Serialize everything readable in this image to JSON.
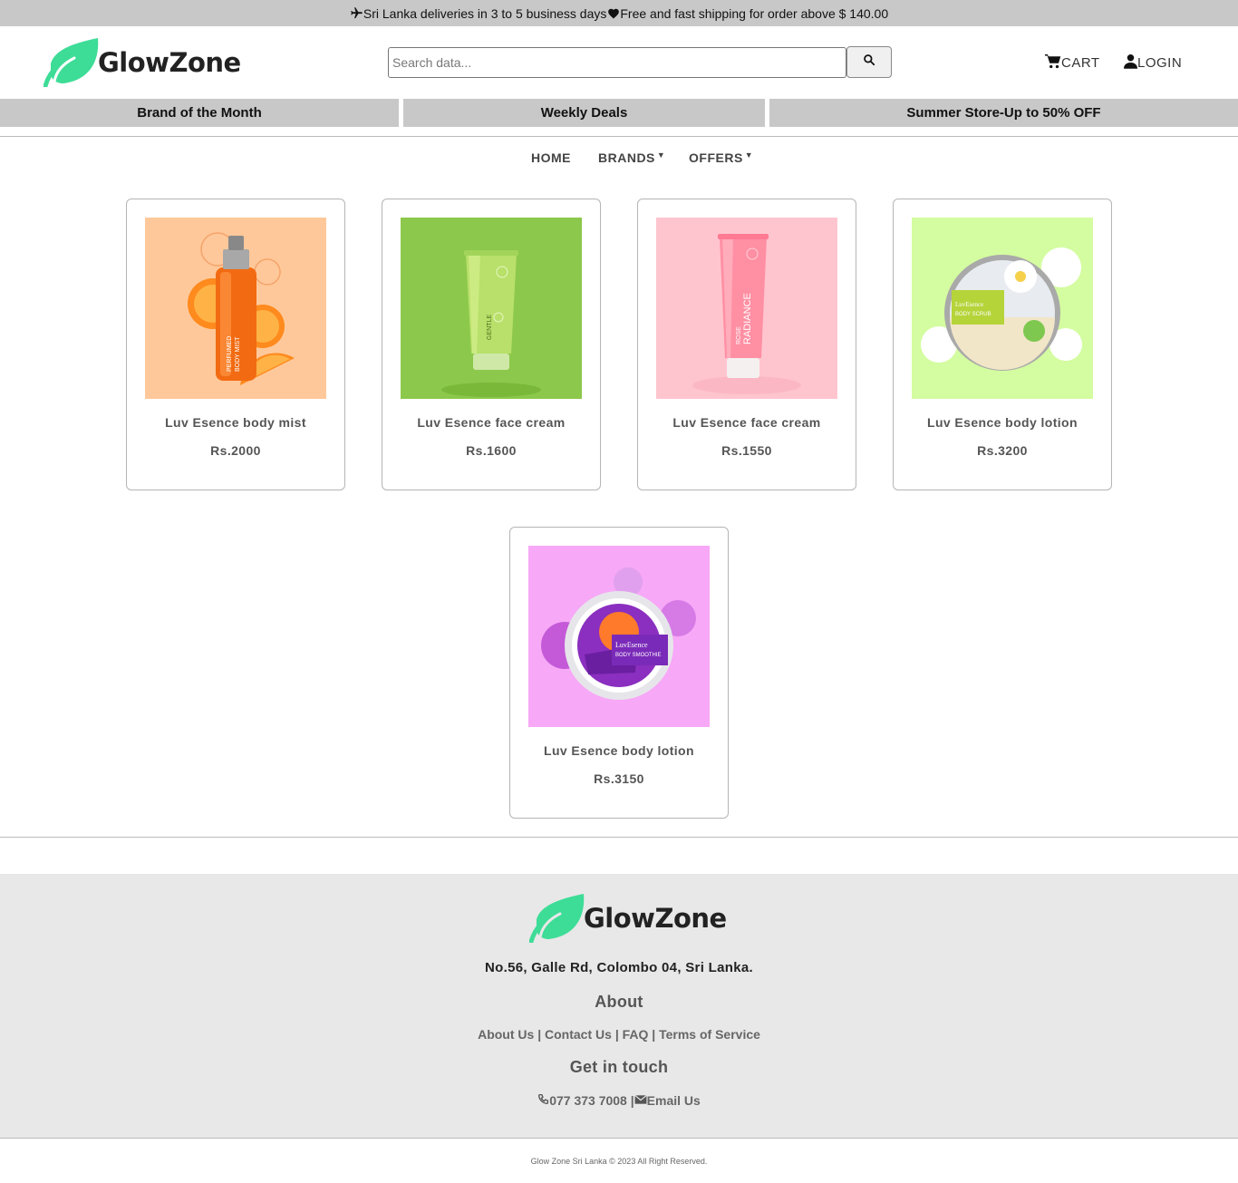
{
  "topbar": {
    "text_part1": "Sri Lanka deliveries in 3 to 5 business days",
    "text_part2": "Free and fast shipping for order above $ 140.00",
    "plane_icon": "airplane-icon",
    "heart_icon": "heart-icon"
  },
  "brand": {
    "name": "GlowZone",
    "leaf_color": "#3ddc97"
  },
  "search": {
    "placeholder": "Search data..."
  },
  "header": {
    "cart_label": "CART",
    "login_label": "LOGIN"
  },
  "promos": [
    "Brand of the Month",
    "Weekly Deals",
    "Summer Store-Up to 50% OFF"
  ],
  "nav": {
    "home": "HOME",
    "brands": "BRANDS",
    "offers": "OFFERS"
  },
  "products": [
    {
      "name": "Luv Esence body mist",
      "price": "Rs.2000",
      "bg": "#ffc89a"
    },
    {
      "name": "Luv Esence face cream",
      "price": "Rs.1600",
      "bg": "#8cc84b"
    },
    {
      "name": "Luv Esence face cream",
      "price": "Rs.1550",
      "bg": "#ffc5cf"
    },
    {
      "name": "Luv Esence body lotion",
      "price": "Rs.3200",
      "bg": "#d4fca0"
    },
    {
      "name": "Luv Esence body lotion",
      "price": "Rs.3150",
      "bg": "#f7a8f7"
    }
  ],
  "product_labels": {
    "mist": [
      "PERFUMED",
      "BODY MIST"
    ],
    "gentle": "GENTLE",
    "rose": [
      "ROSE",
      "RADIANCE"
    ],
    "scrub": [
      "LuvEsence",
      "BODY SCRUB"
    ],
    "smoothie": [
      "LuvEsence",
      "BODY SMOOTHIE"
    ]
  },
  "footer": {
    "address": "No.56, Galle Rd, Colombo 04, Sri Lanka.",
    "about_heading": "About",
    "links": [
      "About Us",
      "Contact Us",
      "FAQ",
      "Terms of Service"
    ],
    "touch_heading": "Get in touch",
    "phone": "077 373 7008",
    "email": "Email Us",
    "copyright": "Glow Zone Sri Lanka © 2023 All Right Reserved."
  }
}
